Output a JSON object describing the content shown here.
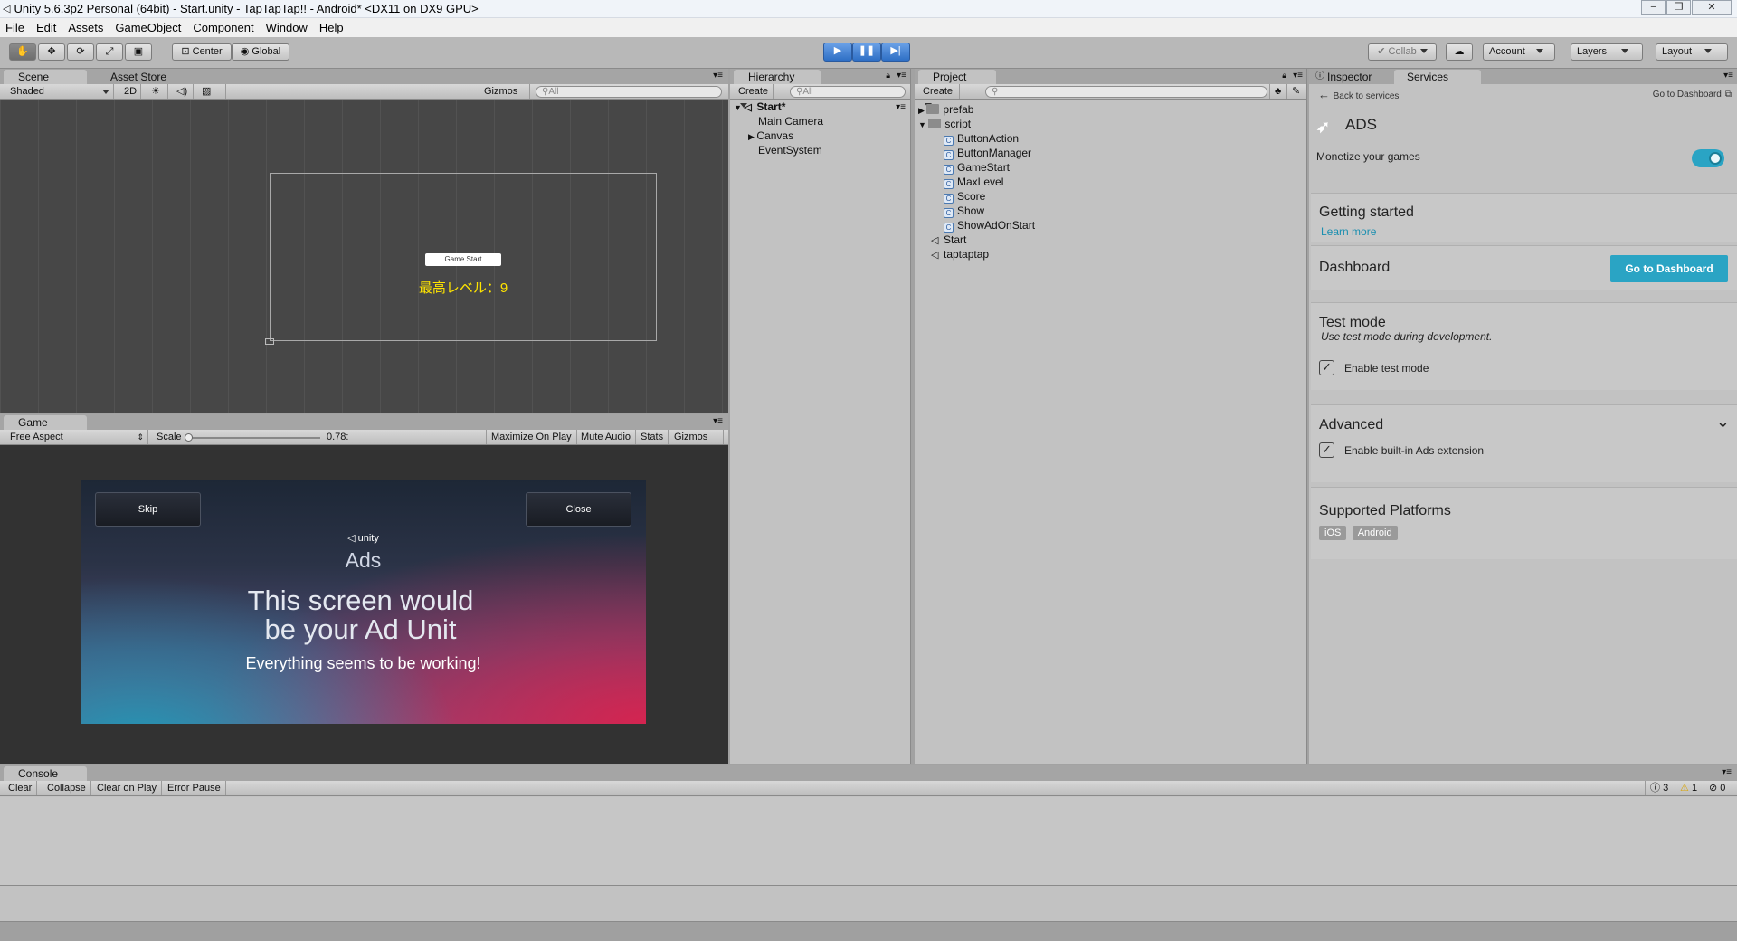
{
  "window": {
    "title": "Unity 5.6.3p2 Personal (64bit) - Start.unity - TapTapTap!! - Android* <DX11 on DX9 GPU>",
    "minimize": "−",
    "restore": "❐",
    "close": "✕"
  },
  "menu": [
    "File",
    "Edit",
    "Assets",
    "GameObject",
    "Component",
    "Window",
    "Help"
  ],
  "toolbar": {
    "center": "Center",
    "global": "Global",
    "collab": "Collab",
    "account": "Account",
    "layers": "Layers",
    "layout": "Layout"
  },
  "scene": {
    "tabs": [
      "Scene",
      "Asset Store"
    ],
    "shading": "Shaded",
    "mode_2d": "2D",
    "gizmos": "Gizmos",
    "search_placeholder": "All",
    "game_start_button": "Game Start",
    "max_level_text": "最高レベル：9"
  },
  "game": {
    "tab": "Game",
    "aspect": "Free Aspect",
    "scale_label": "Scale",
    "scale_value": "0.78:",
    "buttons": [
      "Maximize On Play",
      "Mute Audio",
      "Stats",
      "Gizmos"
    ],
    "ad": {
      "skip": "Skip",
      "close": "Close",
      "logo": "unity",
      "brand": "Ads",
      "headline1": "This screen would",
      "headline2": "be your Ad Unit",
      "tagline": "Everything seems to be working!"
    }
  },
  "hierarchy": {
    "tab": "Hierarchy",
    "create": "Create",
    "search_placeholder": "All",
    "scene_name": "Start*",
    "items": [
      "Main Camera",
      "Canvas",
      "EventSystem"
    ]
  },
  "project": {
    "tab": "Project",
    "create": "Create",
    "folders": [
      "prefab",
      "script"
    ],
    "scripts": [
      "ButtonAction",
      "ButtonManager",
      "GameStart",
      "MaxLevel",
      "Score",
      "Show",
      "ShowAdOnStart"
    ],
    "scenes": [
      "Start",
      "taptaptap"
    ]
  },
  "inspector": {
    "tabs": [
      "Inspector",
      "Services"
    ],
    "back": "Back to services",
    "goto_link": "Go to Dashboard",
    "service_name": "ADS",
    "subtitle": "Monetize your games",
    "toggle_on": true,
    "getting_started": {
      "title": "Getting started",
      "link": "Learn more"
    },
    "dashboard": {
      "title": "Dashboard",
      "button": "Go to Dashboard"
    },
    "test_mode": {
      "title": "Test mode",
      "desc": "Use test mode during development.",
      "checkbox": "Enable test mode",
      "checked": true
    },
    "advanced": {
      "title": "Advanced",
      "checkbox": "Enable built-in Ads extension",
      "checked": true
    },
    "platforms": {
      "title": "Supported Platforms",
      "items": [
        "iOS",
        "Android"
      ]
    },
    "accent": "#2aa4c4"
  },
  "console": {
    "tab": "Console",
    "buttons": [
      "Clear",
      "Collapse",
      "Clear on Play",
      "Error Pause"
    ],
    "info_count": "3",
    "warn_count": "1",
    "error_count": "0"
  }
}
